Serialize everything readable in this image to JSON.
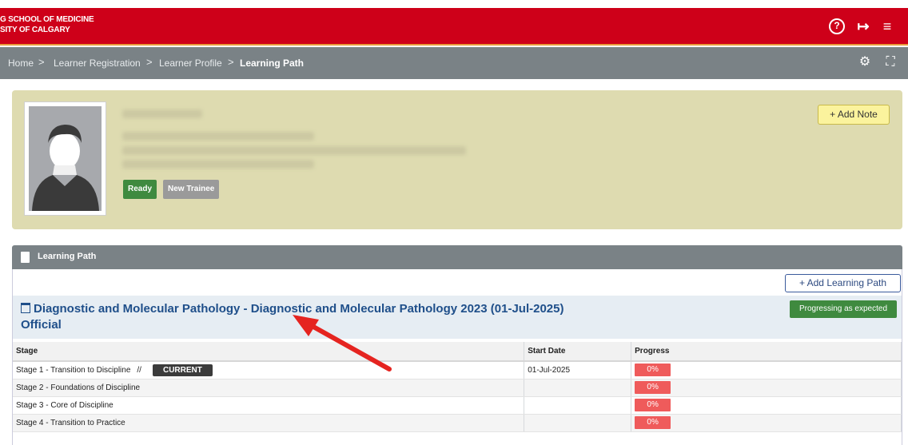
{
  "header": {
    "school_line1": "G SCHOOL OF MEDICINE",
    "school_line2": "SITY OF CALGARY",
    "icons": [
      "help-icon",
      "logout-icon",
      "menu-icon"
    ]
  },
  "breadcrumb": {
    "items": [
      "Home",
      "Learner Registration",
      "Learner Profile",
      "Learning Path"
    ],
    "separator": ">"
  },
  "profile": {
    "badges": [
      "Ready",
      "New Trainee"
    ],
    "add_note_label": "+ Add Note"
  },
  "learning_path": {
    "panel_title": "Learning Path",
    "add_label": "+ Add Learning Path",
    "program_title": "Diagnostic and Molecular Pathology - Diagnostic and Molecular Pathology 2023 (01-Jul-2025) Official",
    "program_status": "Progressing as expected",
    "columns": [
      "Stage",
      "Start Date",
      "Progress"
    ],
    "rows": [
      {
        "stage": "Stage 1 - Transition to Discipline",
        "marker": "//",
        "current": "CURRENT",
        "start_date": "01-Jul-2025",
        "progress": "0%"
      },
      {
        "stage": "Stage 2 - Foundations of Discipline",
        "marker": "",
        "current": "",
        "start_date": "",
        "progress": "0%"
      },
      {
        "stage": "Stage 3 - Core of Discipline",
        "marker": "",
        "current": "",
        "start_date": "",
        "progress": "0%"
      },
      {
        "stage": "Stage 4 - Transition to Practice",
        "marker": "",
        "current": "",
        "start_date": "",
        "progress": "0%"
      }
    ]
  },
  "colors": {
    "brand_red": "#ce0019",
    "nav_gray": "#7a8286",
    "profile_bg": "#dedbb0",
    "status_green": "#3f8a3f",
    "progress_red": "#ef5b5b",
    "annotation_arrow": "#e52420"
  }
}
